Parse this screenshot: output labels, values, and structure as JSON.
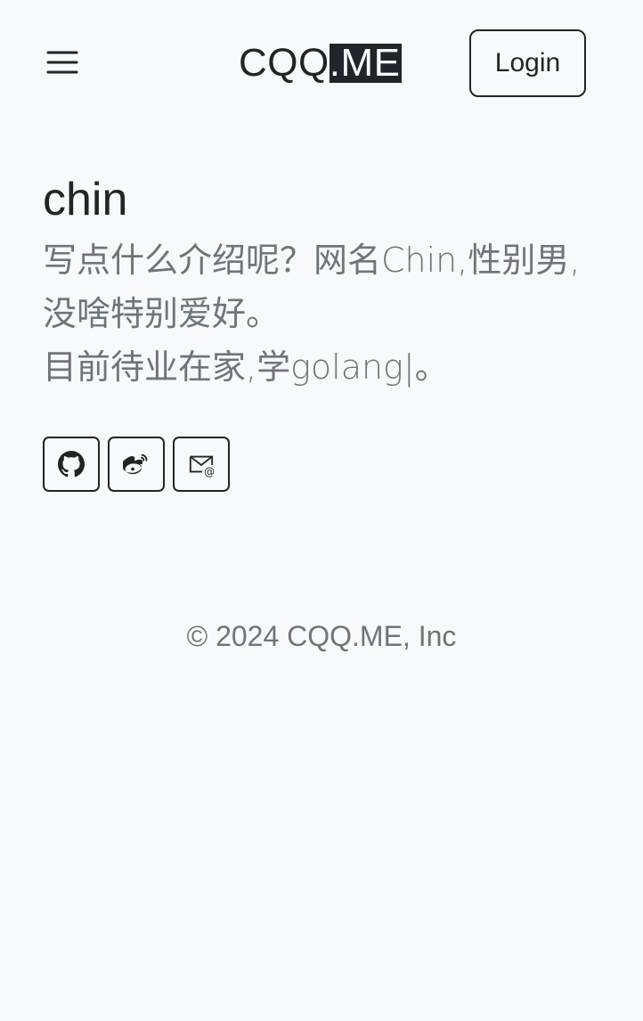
{
  "navbar": {
    "brand_main": "CQQ",
    "brand_highlight": ".ME",
    "login_label": "Login",
    "menu_icon": "hamburger-menu-icon"
  },
  "profile": {
    "name": "chin",
    "bio_lines": [
      "写点什么介绍呢？网名Chin,性别男,",
      "没啥特别爱好。",
      "目前待业在家,学golang|。"
    ]
  },
  "socials": [
    {
      "icon": "github-icon"
    },
    {
      "icon": "weibo-icon"
    },
    {
      "icon": "email-icon"
    }
  ],
  "footer": {
    "copyright": "© 2024 CQQ.ME, Inc"
  }
}
